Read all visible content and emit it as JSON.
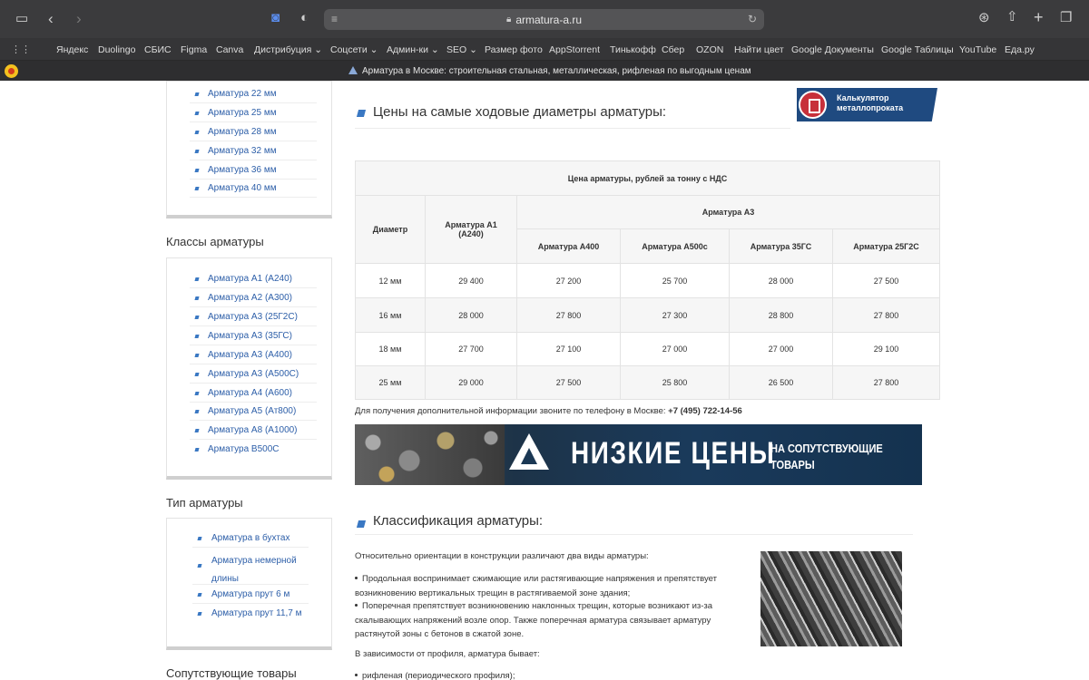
{
  "browser": {
    "url": "armatura-a.ru",
    "tab_title": "Арматура в Москве: строительная стальная, металлическая, рифленая по выгодным ценам"
  },
  "bookmarks": [
    "Яндекс",
    "Duolingo",
    "СБИС",
    "Figma",
    "Canva",
    "Дистрибуция ⌄",
    "Соцсети ⌄",
    "Админ-ки ⌄",
    "SEO ⌄",
    "Размер фото",
    "AppStorrent",
    "Тинькофф",
    "Сбер",
    "OZON",
    "Найти цвет",
    "Google Документы",
    "Google Таблицы",
    "YouTube",
    "Еда.ру"
  ],
  "sidebar": {
    "diameters": [
      "Арматура 22 мм",
      "Арматура 25 мм",
      "Арматура 28 мм",
      "Арматура 32 мм",
      "Арматура 36 мм",
      "Арматура 40 мм"
    ],
    "classes_title": "Классы арматуры",
    "classes": [
      "Арматура А1 (А240)",
      "Арматура А2 (А300)",
      "Арматура А3 (25Г2С)",
      "Арматура А3 (35ГС)",
      "Арматура А3 (А400)",
      "Арматура А3 (А500С)",
      "Арматура А4 (А600)",
      "Арматура А5 (Ат800)",
      "Арматура А8 (А1000)",
      "Арматура В500С"
    ],
    "types_title": "Тип арматуры",
    "types": [
      "Арматура в бухтах",
      "Арматура немерной длины",
      "Арматура прут 6 м",
      "Арматура прут 11,7 м"
    ],
    "related_title": "Сопутствующие товары"
  },
  "main": {
    "prices_title": "Цены на самые ходовые диаметры арматуры:",
    "calc_button": "Калькулятор металлопроката",
    "table": {
      "caption": "Цена арматуры, рублей за тонну с НДС",
      "col_diameter": "Диаметр",
      "col_a1": "Арматура А1 (А240)",
      "group_a3": "Арматура А3",
      "sub_cols": [
        "Арматура А400",
        "Арматура А500с",
        "Арматура 35ГС",
        "Арматура 25Г2С"
      ],
      "rows": [
        {
          "d": "12 мм",
          "a1": "29 400",
          "v": [
            "27 200",
            "25 700",
            "28 000",
            "27 500"
          ]
        },
        {
          "d": "16 мм",
          "a1": "28 000",
          "v": [
            "27 800",
            "27 300",
            "28 800",
            "27 800"
          ]
        },
        {
          "d": "18 мм",
          "a1": "27 700",
          "v": [
            "27 100",
            "27 000",
            "27 000",
            "29 100"
          ]
        },
        {
          "d": "25 мм",
          "a1": "29 000",
          "v": [
            "27 500",
            "25 800",
            "26 500",
            "27 800"
          ]
        }
      ]
    },
    "phone_note": "Для получения дополнительной информации звоните по телефону в Москве: ",
    "phone": "+7 (495) 722-14-56",
    "banner": {
      "big": "НИЗКИЕ ЦЕНЫ",
      "small_1": "НА СОПУТСТВУЮЩИЕ",
      "small_2": "ТОВАРЫ"
    },
    "class_title": "Классификация арматуры:",
    "class_intro": "Относительно ориентации в конструкции различают два виды арматуры:",
    "class_b1": "Продольная воспринимает сжимающие или растягивающие напряжения и препятствует возникновению вертикальных трещин в растягиваемой зоне здания;",
    "class_b2": "Поперечная препятствует возникновению наклонных трещин, которые возникают из-за скалывающих напряжений возле опор. Также поперечная арматура связывает арматуру растянутой зоны с бетонов в сжатой зоне.",
    "profile_intro": "В зависимости от профиля, арматура бывает:",
    "profile_b1": "рифленая (периодического профиля);"
  }
}
